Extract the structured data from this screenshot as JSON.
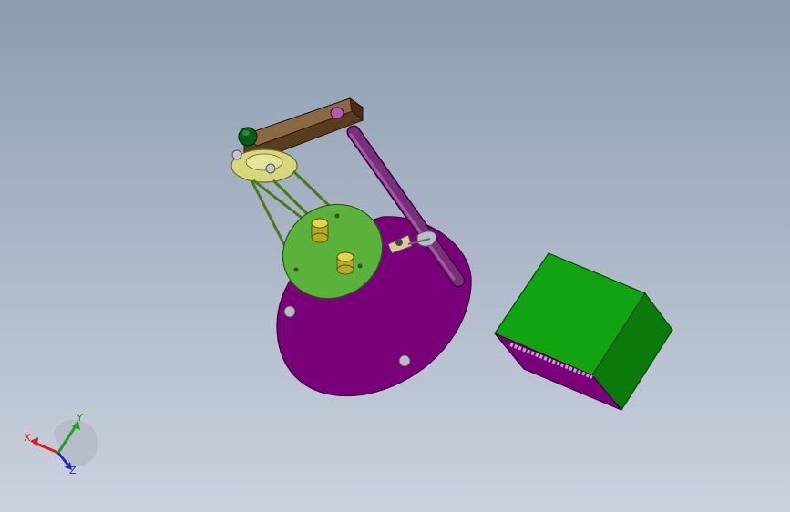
{
  "viewport": {
    "background_top": "#8c9db1",
    "background_bottom": "#cbd2de"
  },
  "model": {
    "base_color": "#7a007a",
    "platform_color": "#5ab23a",
    "arm_color": "#7a5a36",
    "rod_color": "#7a2f7a",
    "pivot_color": "#d6d67a",
    "pin_color": "#d2c83a",
    "knob_color": "#0a5a1a",
    "block_color": "#11a311",
    "block_side_color": "#0a7a0a",
    "block_bottom_color": "#7a007a"
  },
  "triad": {
    "x_label": "X",
    "y_label": "Y",
    "z_label": "Z",
    "x_color": "#d62020",
    "y_color": "#20a020",
    "z_color": "#2030c0"
  }
}
